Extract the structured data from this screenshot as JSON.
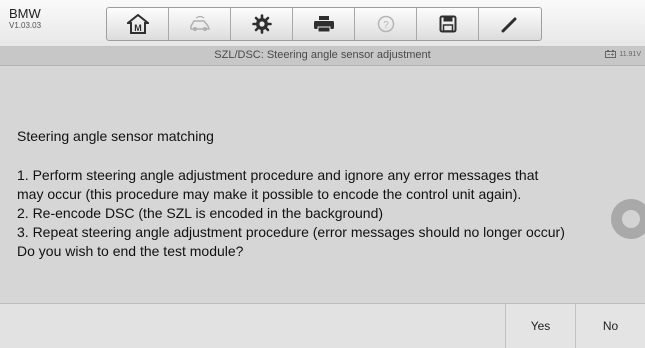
{
  "header": {
    "brand": "BMW",
    "version": "V1.03.03",
    "toolbar": [
      {
        "icon": "home-icon"
      },
      {
        "icon": "vehicle-swap-icon"
      },
      {
        "icon": "gear-icon"
      },
      {
        "icon": "print-icon"
      },
      {
        "icon": "help-icon"
      },
      {
        "icon": "save-icon"
      },
      {
        "icon": "pen-icon"
      }
    ]
  },
  "subbar": {
    "title": "SZL/DSC: Steering angle sensor adjustment",
    "battery": "11.91V"
  },
  "content": {
    "heading": "Steering angle sensor matching",
    "lines": [
      "1. Perform steering angle adjustment procedure and ignore any error messages that",
      "may occur (this procedure may make it possible to encode the control unit again).",
      "2. Re-encode DSC (the SZL is encoded in the background)",
      "3. Repeat steering angle adjustment procedure (error messages should no longer occur)",
      "Do you wish to end the test module?"
    ]
  },
  "footer": {
    "yes": "Yes",
    "no": "No"
  }
}
